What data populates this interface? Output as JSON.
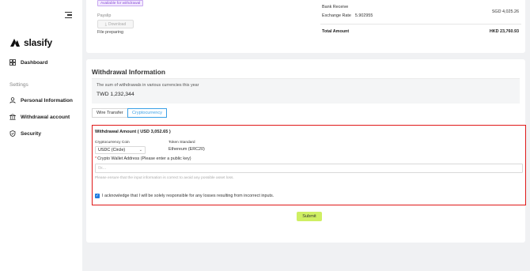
{
  "brand": {
    "name": "slasify"
  },
  "sidebar": {
    "items": [
      {
        "label": "Dashboard",
        "icon": "dashboard-icon"
      },
      {
        "label": "Personal Information",
        "icon": "user-icon"
      },
      {
        "label": "Withdrawal account",
        "icon": "bank-icon"
      },
      {
        "label": "Security",
        "icon": "shield-icon"
      }
    ],
    "section_label": "Settings"
  },
  "summary": {
    "badge": "Available for withdrawal",
    "payslip_label": "Payslip",
    "download_label": "Download",
    "file_status": "File preparing",
    "bank_receive_label": "Bank Receive",
    "bank_receive_value": "SGD 4,025.26",
    "exchange_rate_label": "Exchange Rate",
    "exchange_rate_value": "5.902955",
    "total_label": "Total Amount",
    "total_value": "HKD 23,760.93"
  },
  "withdrawal": {
    "title": "Withdrawal Information",
    "sum_label": "The sum of withdrawals in various currencies this year",
    "sum_value": "TWD 1,232,344",
    "tabs": [
      {
        "label": "Wire Transfer",
        "active": false
      },
      {
        "label": "Cryptocurrency",
        "active": true
      }
    ],
    "form": {
      "amount_label": "Withdrawal Amount ( USD 3,052.65 )",
      "coin_label": "Cryptocurrency Coin",
      "coin_value": "USDC (Circle)",
      "token_label": "Token Standard",
      "token_value": "Ethereum (ERC20)",
      "wallet_label": "Crypto Wallet Address (Please enter a public key)",
      "wallet_placeholder": "0x...",
      "hint": "Please ensure that the input information is correct to avoid any possible asset loss.",
      "ack_label": "I acknowledge that I will be solely responsible for any losses resulting from incorrect inputs.",
      "ack_checked": true
    },
    "submit_label": "Submit"
  },
  "colors": {
    "highlight_border": "#e01818",
    "submit_bg": "#cfef63",
    "active_tab": "#3aa0e6",
    "checkbox": "#1f7ce0"
  }
}
